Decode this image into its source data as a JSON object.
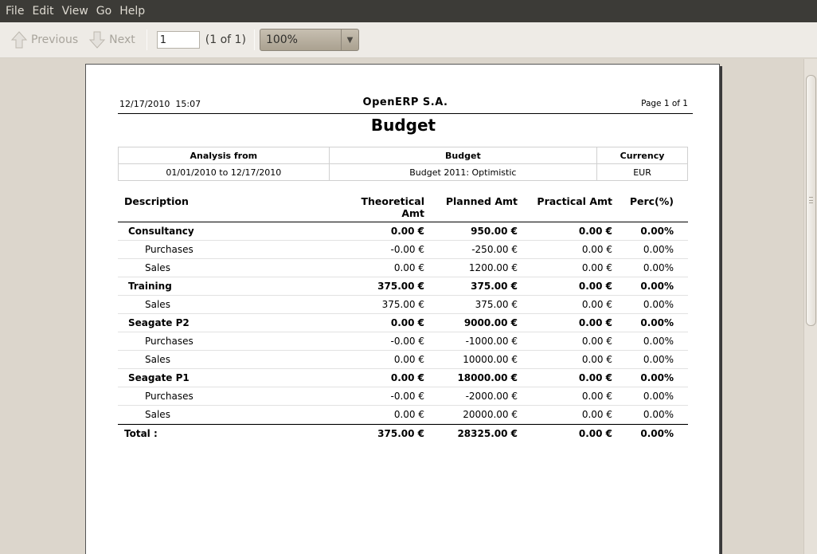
{
  "menu": [
    "File",
    "Edit",
    "View",
    "Go",
    "Help"
  ],
  "toolbar": {
    "previous_label": "Previous",
    "next_label": "Next",
    "page_value": "1",
    "page_count": "(1 of 1)",
    "zoom_value": "100%"
  },
  "report": {
    "date": "12/17/2010  15:07",
    "company": "OpenERP S.A.",
    "page_label": "Page 1 of 1",
    "title": "Budget",
    "info_headers": [
      "Analysis from",
      "Budget",
      "Currency"
    ],
    "info_values": [
      "01/01/2010 to 12/17/2010",
      "Budget 2011: Optimistic",
      "EUR"
    ],
    "columns": {
      "description": "Description",
      "theoretical": "Theoretical Amt",
      "planned": "Planned Amt",
      "practical": "Practical Amt",
      "perc": "Perc(%)"
    },
    "rows": [
      {
        "desc": "Consultancy",
        "theo": "0.00 €",
        "plan": "950.00 €",
        "prac": "0.00 €",
        "perc": "0.00%",
        "group": true
      },
      {
        "desc": "Purchases",
        "theo": "-0.00 €",
        "plan": "-250.00 €",
        "prac": "0.00 €",
        "perc": "0.00%",
        "group": false
      },
      {
        "desc": "Sales",
        "theo": "0.00 €",
        "plan": "1200.00 €",
        "prac": "0.00 €",
        "perc": "0.00%",
        "group": false
      },
      {
        "desc": "Training",
        "theo": "375.00 €",
        "plan": "375.00 €",
        "prac": "0.00 €",
        "perc": "0.00%",
        "group": true
      },
      {
        "desc": "Sales",
        "theo": "375.00 €",
        "plan": "375.00 €",
        "prac": "0.00 €",
        "perc": "0.00%",
        "group": false
      },
      {
        "desc": "Seagate P2",
        "theo": "0.00 €",
        "plan": "9000.00 €",
        "prac": "0.00 €",
        "perc": "0.00%",
        "group": true
      },
      {
        "desc": "Purchases",
        "theo": "-0.00 €",
        "plan": "-1000.00 €",
        "prac": "0.00 €",
        "perc": "0.00%",
        "group": false
      },
      {
        "desc": "Sales",
        "theo": "0.00 €",
        "plan": "10000.00 €",
        "prac": "0.00 €",
        "perc": "0.00%",
        "group": false
      },
      {
        "desc": "Seagate P1",
        "theo": "0.00 €",
        "plan": "18000.00 €",
        "prac": "0.00 €",
        "perc": "0.00%",
        "group": true
      },
      {
        "desc": "Purchases",
        "theo": "-0.00 €",
        "plan": "-2000.00 €",
        "prac": "0.00 €",
        "perc": "0.00%",
        "group": false
      },
      {
        "desc": "Sales",
        "theo": "0.00 €",
        "plan": "20000.00 €",
        "prac": "0.00 €",
        "perc": "0.00%",
        "group": false
      }
    ],
    "total": {
      "label": "Total :",
      "theo": "375.00 €",
      "plan": "28325.00 €",
      "prac": "0.00 €",
      "perc": "0.00%"
    }
  }
}
